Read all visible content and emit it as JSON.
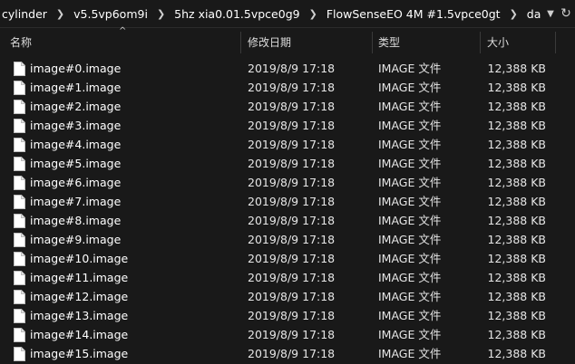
{
  "breadcrumb": {
    "items": [
      "cylinder",
      "v5.5vp6om9i",
      "5hz xia0.01.5vpce0g9",
      "FlowSenseEO 4M #1.5vpce0gt",
      "data"
    ],
    "separator": ">",
    "dropdown_icon": "chevron-down-icon",
    "refresh_icon": "refresh-icon"
  },
  "columns": {
    "name": "名称",
    "date": "修改日期",
    "type": "类型",
    "size": "大小"
  },
  "files": [
    {
      "name": "image#0.image",
      "date": "2019/8/9 17:18",
      "type": "IMAGE 文件",
      "size": "12,388 KB"
    },
    {
      "name": "image#1.image",
      "date": "2019/8/9 17:18",
      "type": "IMAGE 文件",
      "size": "12,388 KB"
    },
    {
      "name": "image#2.image",
      "date": "2019/8/9 17:18",
      "type": "IMAGE 文件",
      "size": "12,388 KB"
    },
    {
      "name": "image#3.image",
      "date": "2019/8/9 17:18",
      "type": "IMAGE 文件",
      "size": "12,388 KB"
    },
    {
      "name": "image#4.image",
      "date": "2019/8/9 17:18",
      "type": "IMAGE 文件",
      "size": "12,388 KB"
    },
    {
      "name": "image#5.image",
      "date": "2019/8/9 17:18",
      "type": "IMAGE 文件",
      "size": "12,388 KB"
    },
    {
      "name": "image#6.image",
      "date": "2019/8/9 17:18",
      "type": "IMAGE 文件",
      "size": "12,388 KB"
    },
    {
      "name": "image#7.image",
      "date": "2019/8/9 17:18",
      "type": "IMAGE 文件",
      "size": "12,388 KB"
    },
    {
      "name": "image#8.image",
      "date": "2019/8/9 17:18",
      "type": "IMAGE 文件",
      "size": "12,388 KB"
    },
    {
      "name": "image#9.image",
      "date": "2019/8/9 17:18",
      "type": "IMAGE 文件",
      "size": "12,388 KB"
    },
    {
      "name": "image#10.image",
      "date": "2019/8/9 17:18",
      "type": "IMAGE 文件",
      "size": "12,388 KB"
    },
    {
      "name": "image#11.image",
      "date": "2019/8/9 17:18",
      "type": "IMAGE 文件",
      "size": "12,388 KB"
    },
    {
      "name": "image#12.image",
      "date": "2019/8/9 17:18",
      "type": "IMAGE 文件",
      "size": "12,388 KB"
    },
    {
      "name": "image#13.image",
      "date": "2019/8/9 17:18",
      "type": "IMAGE 文件",
      "size": "12,388 KB"
    },
    {
      "name": "image#14.image",
      "date": "2019/8/9 17:18",
      "type": "IMAGE 文件",
      "size": "12,388 KB"
    },
    {
      "name": "image#15.image",
      "date": "2019/8/9 17:18",
      "type": "IMAGE 文件",
      "size": "12,388 KB"
    }
  ],
  "file_icon": "document-icon",
  "colors": {
    "background": "#191919",
    "text": "#ffffff",
    "header_separator": "#3a3a3a"
  }
}
